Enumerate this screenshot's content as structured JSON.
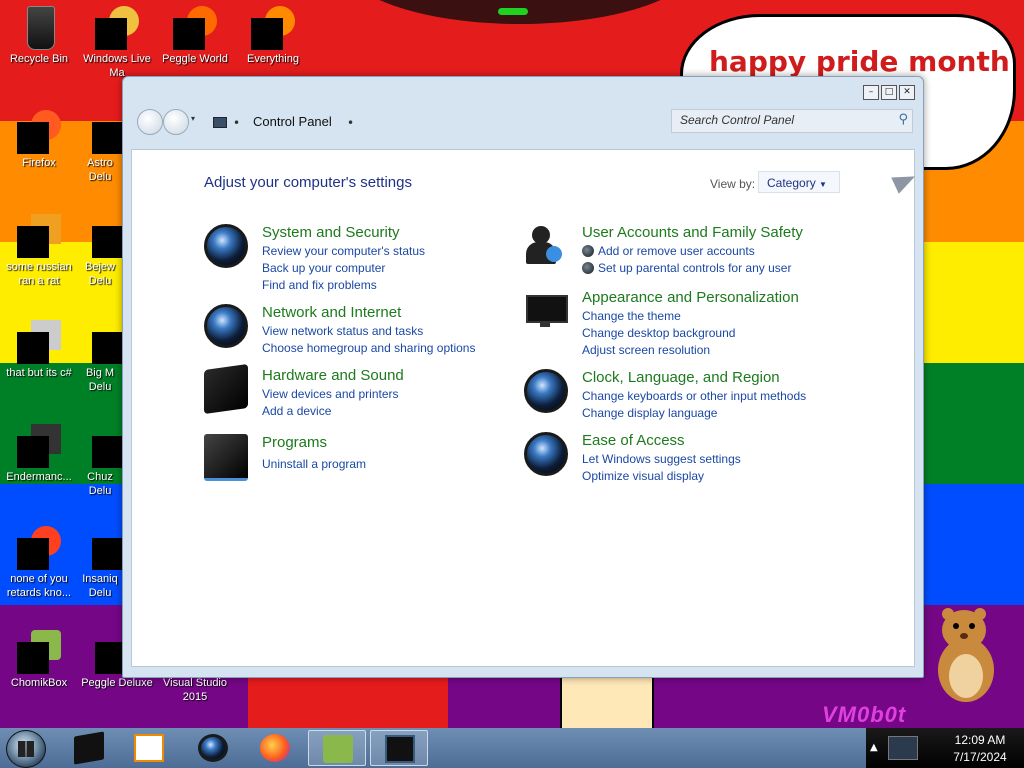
{
  "desktop": {
    "stripes": [
      "#e51c1c",
      "#ff8c00",
      "#ffed00",
      "#008026",
      "#004dff",
      "#750787"
    ],
    "bubble_text": "happy pride month",
    "watermark": "VM0b0t",
    "icons": [
      {
        "label": "Recycle Bin",
        "icon": "recycle-bin-icon"
      },
      {
        "label": "Windows Live Ma",
        "icon": "windows-live-mail-icon"
      },
      {
        "label": "Peggle World",
        "icon": "peggle-world-icon"
      },
      {
        "label": "Everything",
        "icon": "everything-icon"
      },
      {
        "label": "Firefox",
        "icon": "firefox-icon"
      },
      {
        "label": "Astro Delu",
        "icon": "astro-icon"
      },
      {
        "label": "some russian ran a rat",
        "icon": "file-icon"
      },
      {
        "label": "Bejew Delu",
        "icon": "bejeweled-icon"
      },
      {
        "label": "that but its c#",
        "icon": "file-icon"
      },
      {
        "label": "Big M Delu",
        "icon": "big-m-icon"
      },
      {
        "label": "Endermanc...",
        "icon": "enderman-icon"
      },
      {
        "label": "Chuz Delu",
        "icon": "chuzzle-icon"
      },
      {
        "label": "none of you retards kno...",
        "icon": "shortcut-icon"
      },
      {
        "label": "Insaniq Delu",
        "icon": "insaniquarium-icon"
      },
      {
        "label": "ChomikBox",
        "icon": "chomikbox-icon"
      },
      {
        "label": "Peggle Deluxe",
        "icon": "peggle-deluxe-icon"
      },
      {
        "label": "Visual Studio 2015",
        "icon": "visual-studio-icon"
      }
    ]
  },
  "window": {
    "caption_buttons": [
      "minimize",
      "maximize",
      "close"
    ],
    "address": {
      "location": "Control Panel",
      "search_placeholder": "Search Control Panel"
    },
    "heading": "Adjust your computer's settings",
    "view_by_label": "View by:",
    "view_by_value": "Category",
    "categories_left": [
      {
        "title": "System and Security",
        "icon": "system-security-icon",
        "links": [
          "Review your computer's status",
          "Back up your computer",
          "Find and fix problems"
        ]
      },
      {
        "title": "Network and Internet",
        "icon": "network-internet-icon",
        "links": [
          "View network status and tasks",
          "Choose homegroup and sharing options"
        ]
      },
      {
        "title": "Hardware and Sound",
        "icon": "hardware-sound-icon",
        "links": [
          "View devices and printers",
          "Add a device"
        ]
      },
      {
        "title": "Programs",
        "icon": "programs-icon",
        "links": [
          "Uninstall a program"
        ]
      }
    ],
    "categories_right": [
      {
        "title": "User Accounts and Family Safety",
        "icon": "user-accounts-icon",
        "links": [
          "Add or remove user accounts",
          "Set up parental controls for any user"
        ]
      },
      {
        "title": "Appearance and Personalization",
        "icon": "appearance-icon",
        "links": [
          "Change the theme",
          "Change desktop background",
          "Adjust screen resolution"
        ]
      },
      {
        "title": "Clock, Language, and Region",
        "icon": "clock-language-icon",
        "links": [
          "Change keyboards or other input methods",
          "Change display language"
        ]
      },
      {
        "title": "Ease of Access",
        "icon": "ease-of-access-icon",
        "links": [
          "Let Windows suggest settings",
          "Optimize visual display"
        ]
      }
    ]
  },
  "taskbar": {
    "pinned": [
      "media-center-icon",
      "media-player-icon",
      "network-globe-icon",
      "firefox-icon",
      "chomikbox-icon",
      "control-panel-icon"
    ],
    "clock_time": "12:09 AM",
    "clock_date": "7/17/2024"
  }
}
